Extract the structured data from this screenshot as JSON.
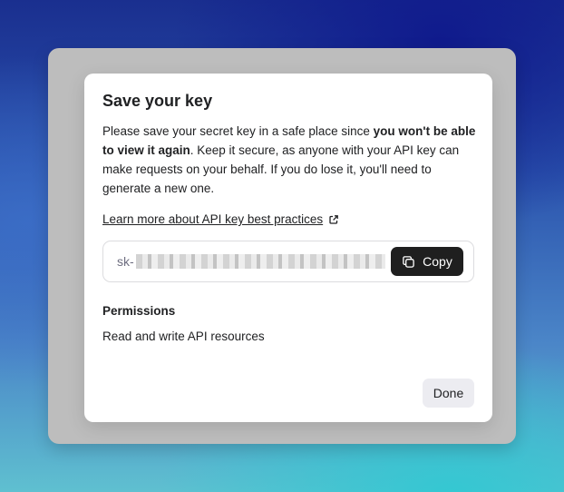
{
  "dialog": {
    "title": "Save your key",
    "description": {
      "part1": "Please save your secret key in a safe place since ",
      "bold": "you won't be able to view it again",
      "part2": ". Keep it secure, as anyone with your API key can make requests on your behalf. If you do lose it, you'll need to generate a new one."
    },
    "learn_more_link": "Learn more about API key best practices",
    "key": {
      "visible_prefix": "sk-",
      "copy_label": "Copy"
    },
    "permissions": {
      "label": "Permissions",
      "value": "Read and write API resources"
    },
    "done_label": "Done"
  },
  "icons": {
    "external": "external-link-icon",
    "copy": "copy-icon"
  },
  "colors": {
    "primary_button": "#1f1f1f",
    "secondary_button": "#ececf1",
    "text": "#202123"
  }
}
